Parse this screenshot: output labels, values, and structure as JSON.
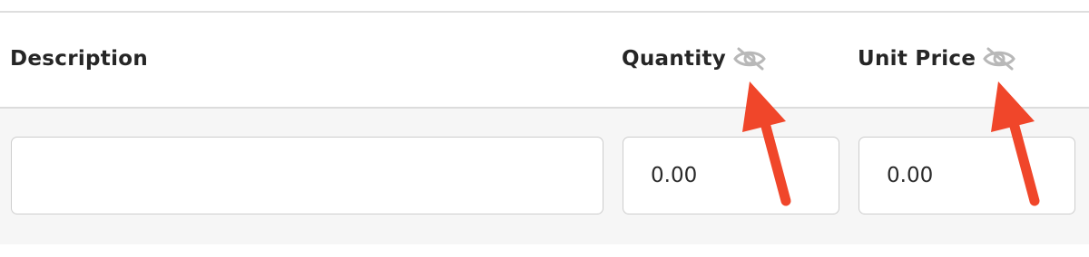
{
  "table": {
    "headers": {
      "description": "Description",
      "quantity": "Quantity",
      "unit_price": "Unit Price"
    },
    "row": {
      "description_value": "",
      "quantity_value": "0.00",
      "unit_price_value": "0.00"
    }
  },
  "icons": {
    "quantity_visibility": "eye-slash-icon",
    "unit_price_visibility": "eye-slash-icon"
  },
  "colors": {
    "annotation_arrow": "#f0462a",
    "icon_gray": "#b8b8b8",
    "header_text": "#262626"
  }
}
